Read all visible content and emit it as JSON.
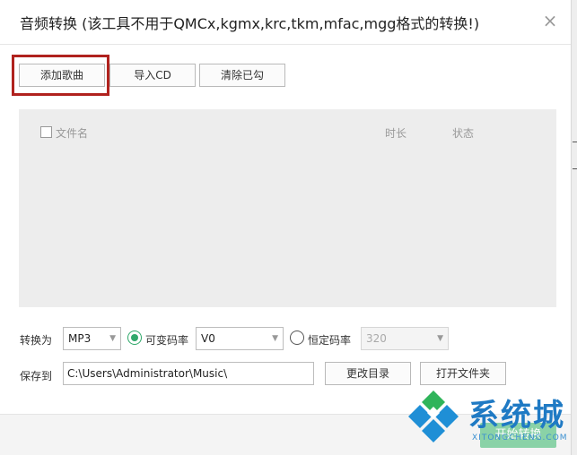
{
  "window": {
    "title": "音频转换 (该工具不用于QMCx,kgmx,krc,tkm,mfac,mgg格式的转换!)",
    "close_symbol": "×"
  },
  "toolbar": {
    "add_song": "添加歌曲",
    "import_cd": "导入CD",
    "clear_checked": "清除已勾"
  },
  "list": {
    "columns": {
      "filename": "文件名",
      "duration": "时长",
      "status": "状态"
    },
    "rows": []
  },
  "convert": {
    "label": "转换为",
    "format": "MP3",
    "vbr_label": "可变码率",
    "vbr_value": "V0",
    "cbr_label": "恒定码率",
    "cbr_value": "320",
    "mode": "vbr"
  },
  "save": {
    "label": "保存到",
    "path": "C:\\Users\\Administrator\\Music\\",
    "change_dir": "更改目录",
    "open_folder": "打开文件夹"
  },
  "footer": {
    "start": "开始转换"
  },
  "watermark": {
    "text": "系统城",
    "sub": "XITONGCHENG.COM"
  },
  "colors": {
    "highlight": "#b0221e",
    "accent_green": "#2fa86a",
    "watermark_blue": "#1f7ac4"
  }
}
